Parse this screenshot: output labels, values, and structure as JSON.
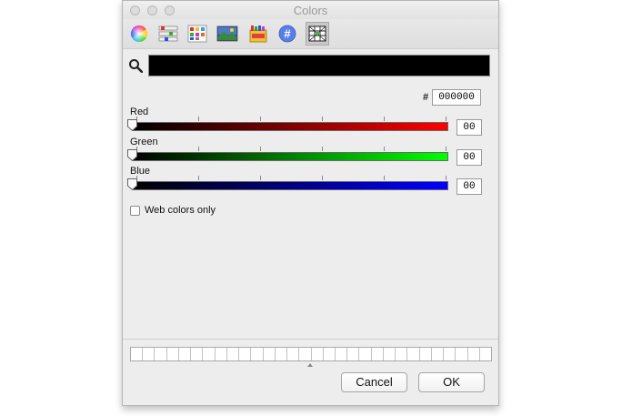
{
  "window": {
    "title": "Colors"
  },
  "toolbar": {
    "tools": [
      {
        "name": "color-wheel"
      },
      {
        "name": "color-sliders"
      },
      {
        "name": "color-palettes"
      },
      {
        "name": "image-palettes"
      },
      {
        "name": "crayons"
      },
      {
        "name": "hex"
      },
      {
        "name": "web-safe"
      }
    ],
    "selected_index": 6
  },
  "current_color": {
    "swatch_color": "#000000"
  },
  "hex": {
    "prefix": "#",
    "value": "000000"
  },
  "sliders": [
    {
      "label": "Red",
      "value": "00",
      "gradient_end": "#ff0000",
      "level": 0
    },
    {
      "label": "Green",
      "value": "00",
      "gradient_end": "#00ff00",
      "level": 0
    },
    {
      "label": "Blue",
      "value": "00",
      "gradient_end": "#0000ff",
      "level": 0
    }
  ],
  "web_colors_only": {
    "label": "Web colors only",
    "checked": false
  },
  "buttons": {
    "cancel": "Cancel",
    "ok": "OK"
  }
}
